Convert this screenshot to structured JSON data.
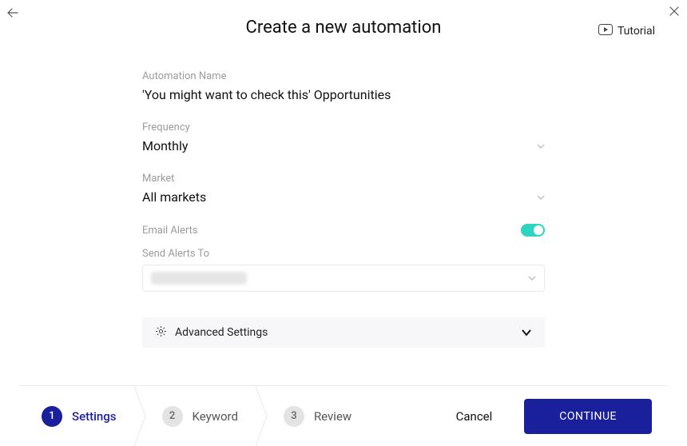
{
  "header": {
    "title": "Create a new automation",
    "tutorial_label": "Tutorial"
  },
  "form": {
    "automation_name": {
      "label": "Automation Name",
      "value": "'You might want to check this' Opportunities"
    },
    "frequency": {
      "label": "Frequency",
      "value": "Monthly"
    },
    "market": {
      "label": "Market",
      "value": "All markets"
    },
    "email_alerts": {
      "label": "Email Alerts",
      "enabled": true
    },
    "send_alerts_to": {
      "label": "Send Alerts To"
    },
    "advanced_settings": {
      "label": "Advanced Settings"
    }
  },
  "steps": [
    {
      "number": "1",
      "label": "Settings",
      "active": true
    },
    {
      "number": "2",
      "label": "Keyword",
      "active": false
    },
    {
      "number": "3",
      "label": "Review",
      "active": false
    }
  ],
  "actions": {
    "cancel": "Cancel",
    "continue": "CONTINUE"
  }
}
